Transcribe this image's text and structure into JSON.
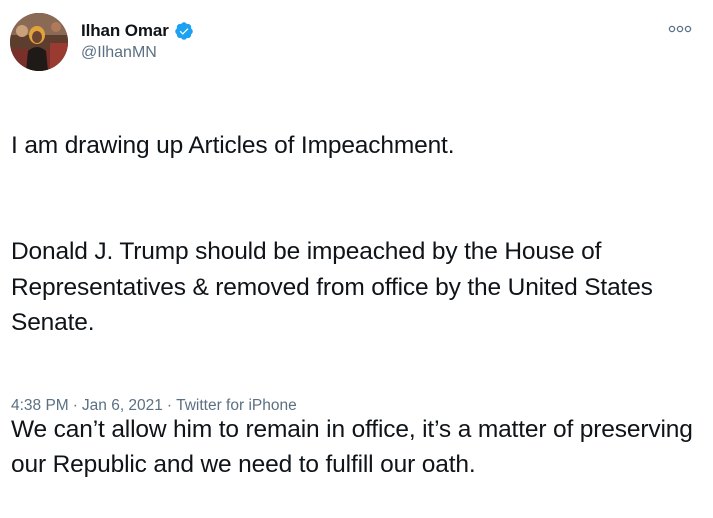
{
  "user": {
    "display_name": "Ilhan Omar",
    "handle": "@IlhanMN",
    "verified": true
  },
  "icons": {
    "verified": "verified-badge-icon",
    "more": "more-options-icon",
    "avatar": "profile-avatar"
  },
  "colors": {
    "verified_blue": "#1da1f2",
    "secondary_text": "#5b7083",
    "primary_text": "#0f1419"
  },
  "tweet": {
    "paragraphs": [
      "I am drawing up Articles of Impeachment.",
      "Donald J. Trump should be impeached by the House of Representatives & removed from office by the United States Senate.",
      "We can’t allow him to remain in office, it’s a matter of preserving our Republic and we need to fulfill our oath."
    ],
    "time": "4:38 PM",
    "date": "Jan 6, 2021",
    "separator": "·",
    "source": "Twitter for iPhone"
  }
}
